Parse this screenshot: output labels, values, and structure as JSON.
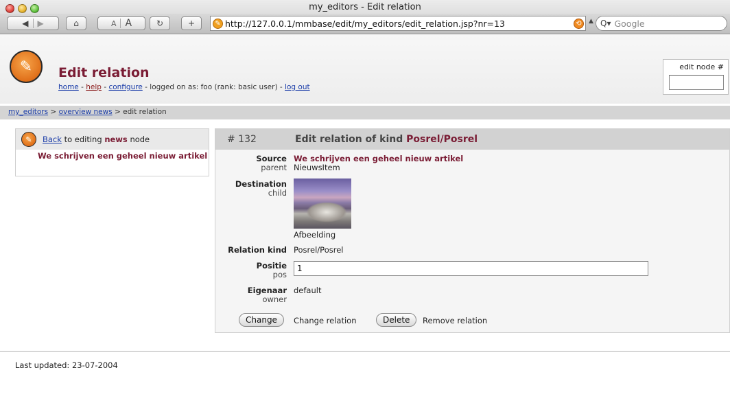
{
  "window": {
    "title": "my_editors - Edit relation"
  },
  "browser": {
    "url": "http://127.0.0.1/mmbase/edit/my_editors/edit_relation.jsp?nr=13",
    "search_placeholder": "Google",
    "text_small_label": "A",
    "text_large_label": "A"
  },
  "header": {
    "title": "Edit relation",
    "links": {
      "home": "home",
      "help": "help",
      "configure": "configure",
      "logged_on": "logged on as: foo (rank: basic user)",
      "log_out": "log out"
    },
    "edit_node_label": "edit node #",
    "edit_node_value": ""
  },
  "breadcrumb": {
    "item1": "my_editors",
    "item2": "overview news",
    "current": "edit relation"
  },
  "left_panel": {
    "back_link": "Back",
    "back_text_pre": "to editing",
    "back_node_type": "news",
    "back_text_post": "node",
    "node_title": "We schrijven een geheel nieuw artikel"
  },
  "main_panel": {
    "number": "# 132",
    "heading_pre": "Edit relation of kind",
    "heading_kind": "Posrel/Posrel",
    "source_label": "Source",
    "source_sublabel": "parent",
    "source_title": "We schrijven een geheel nieuw artikel",
    "source_type": "NieuwsItem",
    "destination_label": "Destination",
    "destination_sublabel": "child",
    "destination_type": "Afbeelding",
    "relation_kind_label": "Relation kind",
    "relation_kind_value": "Posrel/Posrel",
    "positie_label": "Positie",
    "positie_sublabel": "pos",
    "positie_value": "1",
    "eigenaar_label": "Eigenaar",
    "eigenaar_sublabel": "owner",
    "eigenaar_value": "default",
    "change_button": "Change",
    "change_note": "Change relation",
    "delete_button": "Delete",
    "delete_note": "Remove relation"
  },
  "footer": {
    "last_updated": "Last updated: 23-07-2004"
  },
  "colors": {
    "accent": "#7a1c34",
    "link": "#1a3ca8",
    "crumb_bar": "#d4d4d4"
  }
}
